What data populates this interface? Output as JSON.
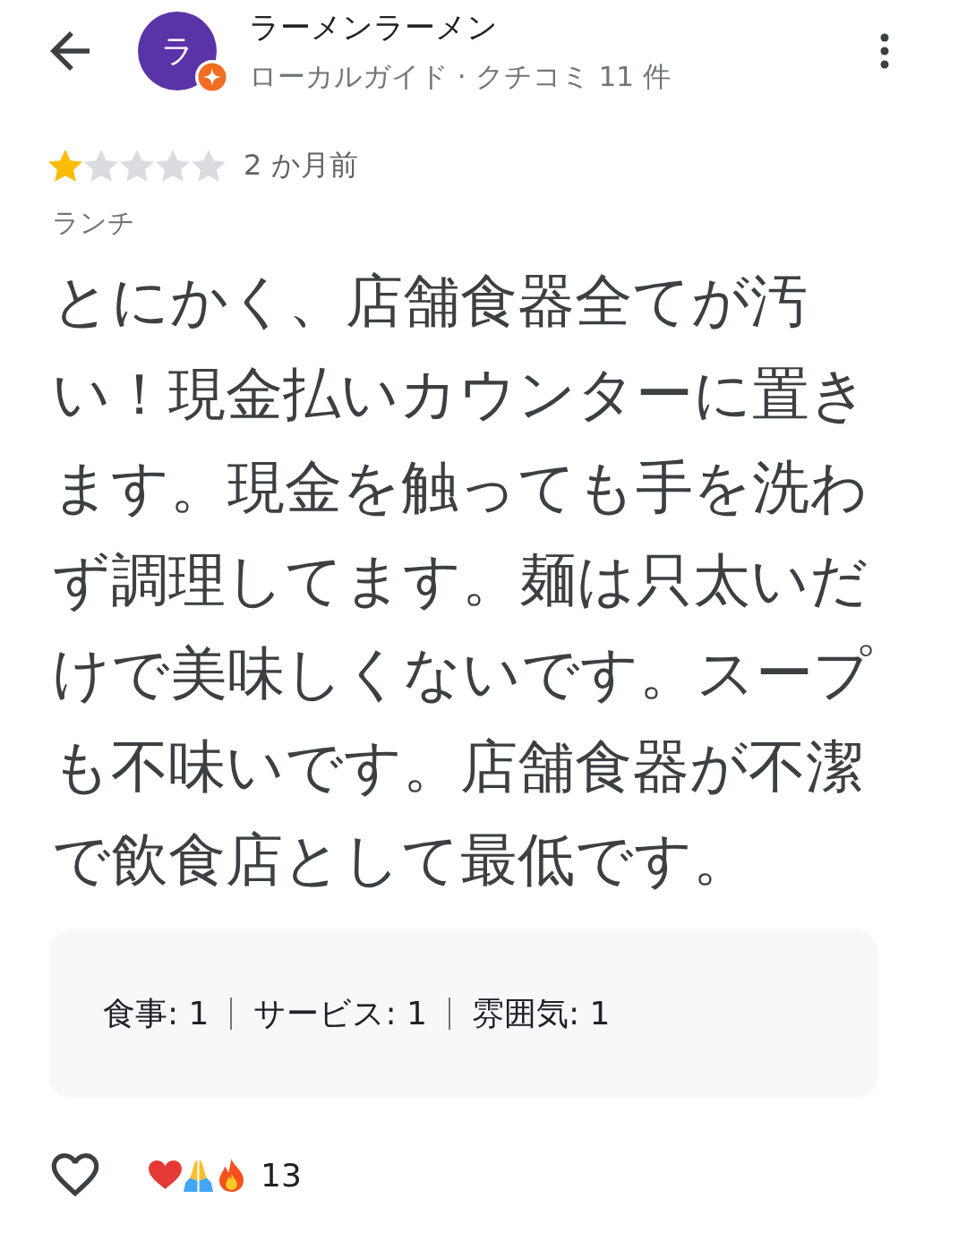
{
  "reviewer": {
    "avatar_letter": "ラ",
    "name": "ラーメンラーメン",
    "subtitle": "ローカルガイド · クチコミ 11 件",
    "local_guide": true
  },
  "review": {
    "stars": 1,
    "time": "2 か月前",
    "meal_type": "ランチ",
    "text": "とにかく、店舗食器全てが汚い！現金払いカウンターに置きます。現金を触っても手を洗わず調理してます。麺は只太いだけで美味しくないです。スープも不味いです。店舗食器が不潔で飲食店として最低です。"
  },
  "aspects": [
    {
      "label": "食事: 1"
    },
    {
      "label": "サービス: 1"
    },
    {
      "label": "雰囲気: 1"
    }
  ],
  "reactions": {
    "count": "13"
  }
}
